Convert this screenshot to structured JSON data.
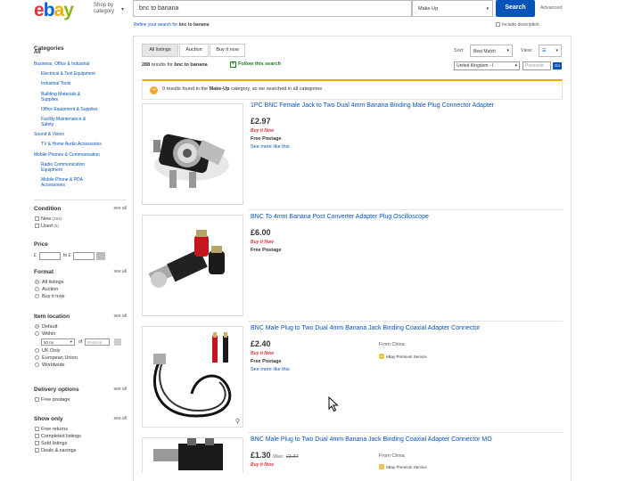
{
  "header": {
    "shop_by": "Shop by category",
    "search_value": "bnc to banana",
    "category": "Make-Up",
    "search_button": "Search",
    "advanced": "Advanced",
    "refine_prefix": "Refine your search for",
    "refine_query": "bnc to banana",
    "include_description": "Include description"
  },
  "sidebar": {
    "categories_title": "Categories",
    "all": "All",
    "cats": [
      {
        "label": "Business, Office & Industrial",
        "level": 0
      },
      {
        "label": "Electrical & Test Equipment",
        "level": 1
      },
      {
        "label": "Industrial Tools",
        "level": 1
      },
      {
        "label": "Building Materials & Supplies",
        "level": 1
      },
      {
        "label": "Office Equipment & Supplies",
        "level": 1
      },
      {
        "label": "Facility Maintenance & Safety",
        "level": 1
      },
      {
        "label": "Sound & Vision",
        "level": 0
      },
      {
        "label": "TV & Home Audio Accessories",
        "level": 1
      },
      {
        "label": "Mobile Phones & Communication",
        "level": 0
      },
      {
        "label": "Radio Communication Equipment",
        "level": 1
      },
      {
        "label": "Mobile Phone & PDA Accessories",
        "level": 1
      }
    ],
    "see_all": "see all",
    "condition": {
      "title": "Condition",
      "options": [
        {
          "label": "New",
          "count": "(283)"
        },
        {
          "label": "Used",
          "count": "(5)"
        }
      ]
    },
    "price": {
      "title": "Price",
      "currency": "£",
      "to": "to £"
    },
    "format": {
      "title": "Format",
      "options": [
        "All listings",
        "Auction",
        "Buy it now"
      ]
    },
    "location": {
      "title": "Item location",
      "options": [
        "Default",
        "Within",
        "UK Only",
        "European Union",
        "Worldwide"
      ],
      "within_value": "50 mi",
      "of": "of",
      "postcode_placeholder": "Postcod"
    },
    "delivery": {
      "title": "Delivery options",
      "options": [
        "Free postage"
      ]
    },
    "show_only": {
      "title": "Show only",
      "options": [
        "Free returns",
        "Completed listings",
        "Sold listings",
        "Deals & savings"
      ]
    }
  },
  "results": {
    "tabs": [
      "All listings",
      "Auction",
      "Buy it now"
    ],
    "sort_label": "Sort:",
    "sort_value": "Best Match",
    "view_label": "View:",
    "count": "288",
    "count_mid": "results for",
    "count_query": "bnc to banana",
    "follow": "Follow this search",
    "country": "United Kingdom - I",
    "postcode_placeholder": "Postcode",
    "go": "Go",
    "notice_pre": "0 results found in the",
    "notice_cat": "Make-Up",
    "notice_post": "category, so we searched in all categories"
  },
  "items": [
    {
      "title": "1PC BNC Female Jack to Two Dual 4mm Banana Binding Male Plug Connector Adapter",
      "price": "£2.97",
      "postage": "Free Postage",
      "see_more": "See more like this"
    },
    {
      "title": "BNC To 4mm Banana Post Converter Adapter Plug Oscilloscope",
      "price": "£6.00",
      "postage": "Free Postage"
    },
    {
      "title": "BNC Male Plug to Two Dual 4mm Banana Jack Binding Coaxial Adapter Connector",
      "price": "£2.40",
      "postage": "Free Postage",
      "see_more": "See more like this",
      "from": "From China",
      "premium": "eBay Premium Service"
    },
    {
      "title": "BNC Male Plug to Two Dual 4mm Banana Jack Binding Coaxial Adapter Connector MO",
      "price": "£1.30",
      "was_label": "Was:",
      "was_price": "£1.37",
      "from": "From China",
      "premium": "eBay Premium Service"
    }
  ],
  "buy_it_now": "Buy it Now",
  "colors": {
    "accent": "#0654ba",
    "ebay_red": "#e53238",
    "ebay_blue": "#0064d2",
    "ebay_yellow": "#f5af02",
    "ebay_green": "#86b817"
  }
}
